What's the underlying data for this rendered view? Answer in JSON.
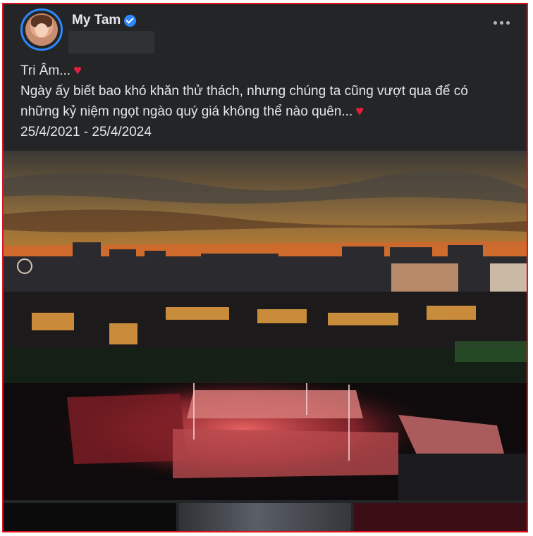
{
  "post": {
    "author": "My Tam",
    "caption_lines": [
      "Tri Âm...",
      "Ngày ấy biết bao khó khăn thử thách, nhưng chúng ta cũng vượt qua để có",
      "những kỷ niệm ngọt ngào quý giá không thể nào quên...",
      "25/4/2021 - 25/4/2024"
    ],
    "heart_glyph": "♥"
  },
  "icons": [
    "verified-badge-icon",
    "more-options-icon",
    "heart-icon"
  ],
  "colors": {
    "background": "#242526",
    "text": "#e4e6eb",
    "verified": "#2d88ff",
    "heart": "#e41e3f",
    "frame": "#e0141e"
  }
}
